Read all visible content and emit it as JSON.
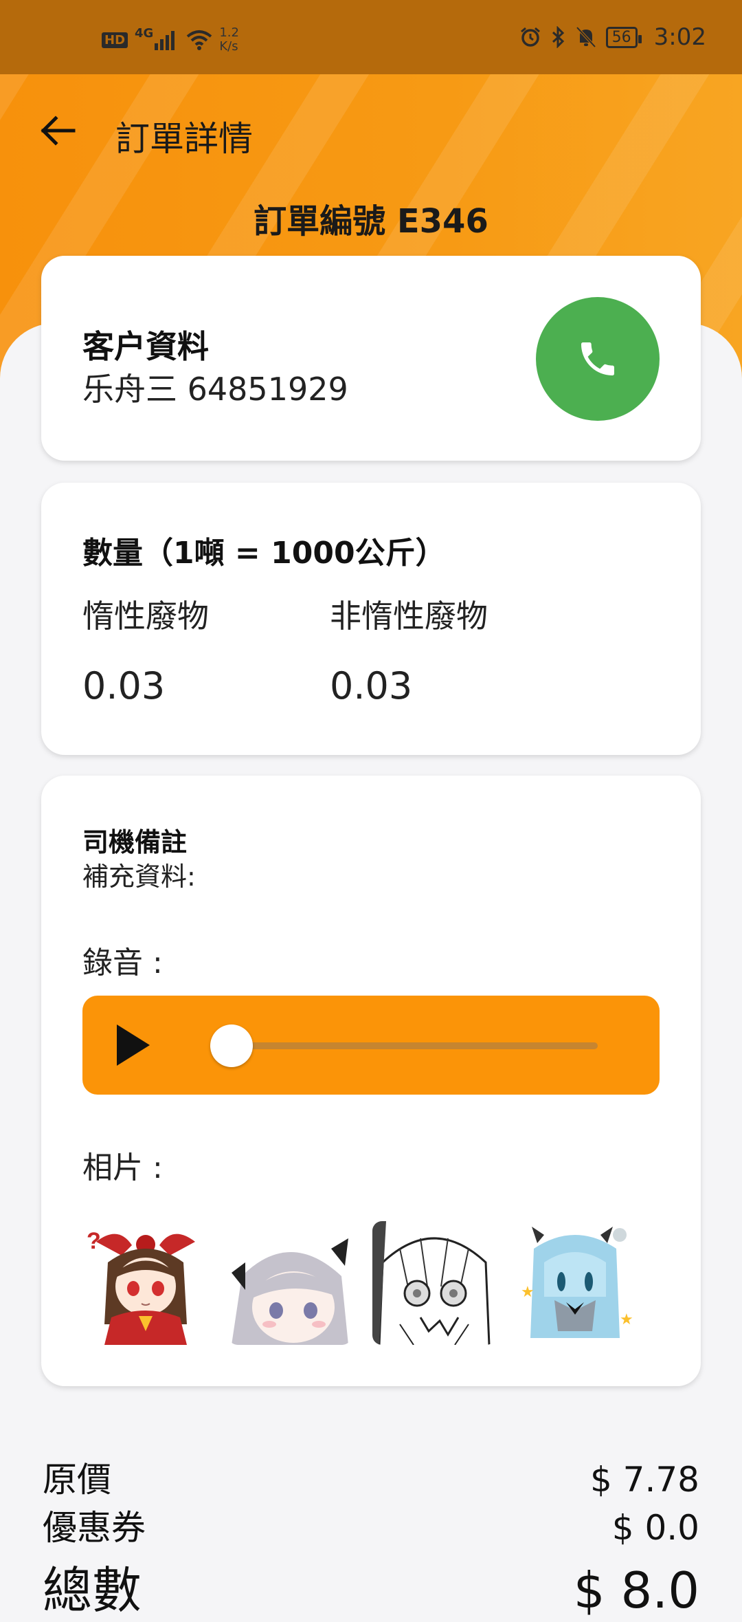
{
  "status_bar": {
    "hd": "HD",
    "network": "4G",
    "speed_value": "1.2",
    "speed_unit": "K/s",
    "battery": "56",
    "time": "3:02",
    "icons": [
      "hd-badge-icon",
      "signal-icon",
      "wifi-icon",
      "alarm-icon",
      "bluetooth-icon",
      "mute-icon",
      "battery-icon"
    ]
  },
  "appbar": {
    "title": "訂單詳情",
    "back_icon": "arrow-left-icon"
  },
  "order": {
    "number": "訂單編號 E346"
  },
  "customer": {
    "title": "客户資料",
    "info": "乐舟三 64851929",
    "call_icon": "phone-icon",
    "call_color": "#4caf50"
  },
  "quantity": {
    "title": "數量（1噸 = 1000公斤）",
    "inert_label": "惰性廢物",
    "inert_value": "0.03",
    "non_inert_label": "非惰性廢物",
    "non_inert_value": "0.03"
  },
  "notes": {
    "title": "司機備註",
    "extra": "補充資料:",
    "recording_label": "錄音 :",
    "photo_label": "相片 :",
    "player_progress": 0.0,
    "player_color": "#fb9408",
    "photos": [
      "photo-1",
      "photo-2",
      "photo-3",
      "photo-4"
    ]
  },
  "summary": {
    "original_label": "原價",
    "original_value": "$ 7.78",
    "coupon_label": "優惠券",
    "coupon_value": "$ 0.0",
    "total_label": "總數",
    "total_value": "$ 8.0"
  },
  "colors": {
    "accent": "#f7910c",
    "status_bar": "#b56a0c"
  }
}
